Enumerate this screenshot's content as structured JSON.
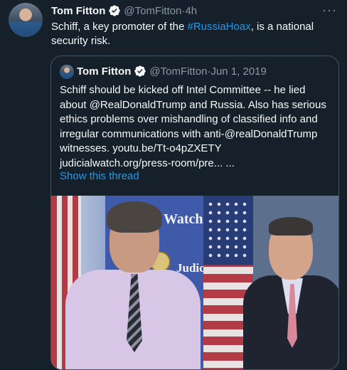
{
  "tweet": {
    "author_name": "Tom Fitton",
    "author_handle": "@TomFitton",
    "separator": " · ",
    "time": "4h",
    "more_label": "···",
    "text_before": "Schiff, a key promoter of the ",
    "hashtag": "#RussiaHoax",
    "text_after": ", is a national security risk."
  },
  "quoted": {
    "author_name": "Tom Fitton",
    "author_handle": "@TomFitton",
    "separator": " · ",
    "date": "Jun 1, 2019",
    "text": "Schiff should be kicked off Intel Committee -- he lied about @RealDonaldTrump and Russia. Also has serious ethics problems over mishandling of classified info and irregular communications with anti-@realDonaldTrump witnesses. youtu.be/Tt-o4pZXETY judicialwatch.org/press-room/pre... ...",
    "show_thread": "Show this thread",
    "photo": {
      "banner_text_top": "Watch",
      "banner_text_bottom": "Judici"
    }
  },
  "colors": {
    "background": "#15202b",
    "accent": "#1d9bf0",
    "muted": "#8b98a5",
    "border": "#425364"
  },
  "icons": {
    "verified": "verified-badge-icon",
    "more": "more-options-icon"
  }
}
